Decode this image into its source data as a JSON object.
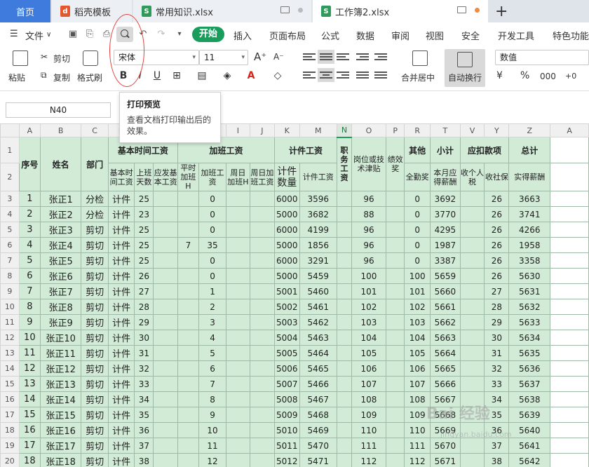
{
  "tabs": {
    "home": "首页",
    "template": "稻壳模板",
    "file1": "常用知识.xlsx",
    "file2": "工作簿2.xlsx"
  },
  "menu": {
    "file": "文件",
    "start": "开始",
    "items": [
      "插入",
      "页面布局",
      "公式",
      "数据",
      "审阅",
      "视图",
      "安全",
      "开发工具",
      "特色功能"
    ]
  },
  "ribbon": {
    "paste": "粘贴",
    "cut": "剪切",
    "copy": "复制",
    "format_painter": "格式刷",
    "font_name": "宋体",
    "font_size": "11",
    "merge_center": "合并居中",
    "wrap_text": "自动换行",
    "number_format": "数值"
  },
  "name_box": "N40",
  "tooltip": {
    "title": "打印预览",
    "desc": "查看文档打印输出后的效果。"
  },
  "columns": [
    "A",
    "B",
    "C",
    "D",
    "E",
    "F",
    "G",
    "H",
    "I",
    "J",
    "K",
    "M",
    "N",
    "O",
    "P",
    "R",
    "T",
    "V",
    "Y",
    "Z",
    "A"
  ],
  "header": {
    "row1": {
      "seq": "序号",
      "name": "姓名",
      "dept": "部门",
      "basic": "基本时间工资",
      "overtime": "加班工资",
      "piece": "计件工资",
      "post_wage": "职务工资",
      "post_allow": "岗位或技术津贴",
      "bonus": "绩效奖",
      "other": "其他",
      "subtotal": "小计",
      "deduct": "应扣款项",
      "total": "总计"
    },
    "row2": {
      "basic_time": "基本时间工资",
      "work_days": "上班天数",
      "basic_pay": "应发基本工资",
      "normal_ot": "平时加班H",
      "ot_wage": "加班工资",
      "weekend_ot": "周日加班H",
      "weekend_pay": "周日加班工资",
      "piece_qty": "计件数量",
      "piece_wage": "计件工资",
      "full_attend": "全勤奖",
      "month_pay": "本月应得薪酬",
      "income_tax": "收个人税",
      "social": "收社保",
      "net": "实得薪酬"
    }
  },
  "rows": [
    {
      "r": "3",
      "no": "1",
      "name": "张正1",
      "dept": "分检",
      "basic": "计件",
      "days": "25",
      "ot_h": "",
      "ot": "0",
      "qty": "6000",
      "piece": "3596",
      "allow": "96",
      "full": "0",
      "month": "3692",
      "social": "26",
      "net": "3663"
    },
    {
      "r": "4",
      "no": "2",
      "name": "张正2",
      "dept": "分检",
      "basic": "计件",
      "days": "23",
      "ot_h": "",
      "ot": "0",
      "qty": "5000",
      "piece": "3682",
      "allow": "88",
      "full": "0",
      "month": "3770",
      "social": "26",
      "net": "3741"
    },
    {
      "r": "5",
      "no": "3",
      "name": "张正3",
      "dept": "剪切",
      "basic": "计件",
      "days": "25",
      "ot_h": "",
      "ot": "0",
      "qty": "6000",
      "piece": "4199",
      "allow": "96",
      "full": "0",
      "month": "4295",
      "social": "26",
      "net": "4266"
    },
    {
      "r": "6",
      "no": "4",
      "name": "张正4",
      "dept": "剪切",
      "basic": "计件",
      "days": "25",
      "ot_h": "7",
      "ot": "35",
      "qty": "5000",
      "piece": "1856",
      "allow": "96",
      "full": "0",
      "month": "1987",
      "social": "26",
      "net": "1958"
    },
    {
      "r": "7",
      "no": "5",
      "name": "张正5",
      "dept": "剪切",
      "basic": "计件",
      "days": "25",
      "ot_h": "",
      "ot": "0",
      "qty": "6000",
      "piece": "3291",
      "allow": "96",
      "full": "0",
      "month": "3387",
      "social": "26",
      "net": "3358"
    },
    {
      "r": "8",
      "no": "6",
      "name": "张正6",
      "dept": "剪切",
      "basic": "计件",
      "days": "26",
      "ot_h": "",
      "ot": "0",
      "qty": "5000",
      "piece": "5459",
      "allow": "100",
      "full": "100",
      "month": "5659",
      "social": "26",
      "net": "5630"
    },
    {
      "r": "9",
      "no": "7",
      "name": "张正7",
      "dept": "剪切",
      "basic": "计件",
      "days": "27",
      "ot_h": "",
      "ot": "1",
      "qty": "5001",
      "piece": "5460",
      "allow": "101",
      "full": "101",
      "month": "5660",
      "social": "27",
      "net": "5631"
    },
    {
      "r": "10",
      "no": "8",
      "name": "张正8",
      "dept": "剪切",
      "basic": "计件",
      "days": "28",
      "ot_h": "",
      "ot": "2",
      "qty": "5002",
      "piece": "5461",
      "allow": "102",
      "full": "102",
      "month": "5661",
      "social": "28",
      "net": "5632"
    },
    {
      "r": "11",
      "no": "9",
      "name": "张正9",
      "dept": "剪切",
      "basic": "计件",
      "days": "29",
      "ot_h": "",
      "ot": "3",
      "qty": "5003",
      "piece": "5462",
      "allow": "103",
      "full": "103",
      "month": "5662",
      "social": "29",
      "net": "5633"
    },
    {
      "r": "12",
      "no": "10",
      "name": "张正10",
      "dept": "剪切",
      "basic": "计件",
      "days": "30",
      "ot_h": "",
      "ot": "4",
      "qty": "5004",
      "piece": "5463",
      "allow": "104",
      "full": "104",
      "month": "5663",
      "social": "30",
      "net": "5634"
    },
    {
      "r": "13",
      "no": "11",
      "name": "张正11",
      "dept": "剪切",
      "basic": "计件",
      "days": "31",
      "ot_h": "",
      "ot": "5",
      "qty": "5005",
      "piece": "5464",
      "allow": "105",
      "full": "105",
      "month": "5664",
      "social": "31",
      "net": "5635"
    },
    {
      "r": "14",
      "no": "12",
      "name": "张正12",
      "dept": "剪切",
      "basic": "计件",
      "days": "32",
      "ot_h": "",
      "ot": "6",
      "qty": "5006",
      "piece": "5465",
      "allow": "106",
      "full": "106",
      "month": "5665",
      "social": "32",
      "net": "5636"
    },
    {
      "r": "15",
      "no": "13",
      "name": "张正13",
      "dept": "剪切",
      "basic": "计件",
      "days": "33",
      "ot_h": "",
      "ot": "7",
      "qty": "5007",
      "piece": "5466",
      "allow": "107",
      "full": "107",
      "month": "5666",
      "social": "33",
      "net": "5637"
    },
    {
      "r": "16",
      "no": "14",
      "name": "张正14",
      "dept": "剪切",
      "basic": "计件",
      "days": "34",
      "ot_h": "",
      "ot": "8",
      "qty": "5008",
      "piece": "5467",
      "allow": "108",
      "full": "108",
      "month": "5667",
      "social": "34",
      "net": "5638"
    },
    {
      "r": "17",
      "no": "15",
      "name": "张正15",
      "dept": "剪切",
      "basic": "计件",
      "days": "35",
      "ot_h": "",
      "ot": "9",
      "qty": "5009",
      "piece": "5468",
      "allow": "109",
      "full": "109",
      "month": "5668",
      "social": "35",
      "net": "5639"
    },
    {
      "r": "18",
      "no": "16",
      "name": "张正16",
      "dept": "剪切",
      "basic": "计件",
      "days": "36",
      "ot_h": "",
      "ot": "10",
      "qty": "5010",
      "piece": "5469",
      "allow": "110",
      "full": "110",
      "month": "5669",
      "social": "36",
      "net": "5640"
    },
    {
      "r": "19",
      "no": "17",
      "name": "张正17",
      "dept": "剪切",
      "basic": "计件",
      "days": "37",
      "ot_h": "",
      "ot": "11",
      "qty": "5011",
      "piece": "5470",
      "allow": "111",
      "full": "111",
      "month": "5670",
      "social": "37",
      "net": "5641"
    },
    {
      "r": "20",
      "no": "18",
      "name": "张正18",
      "dept": "剪切",
      "basic": "计件",
      "days": "38",
      "ot_h": "",
      "ot": "12",
      "qty": "5012",
      "piece": "5471",
      "allow": "112",
      "full": "112",
      "month": "5671",
      "social": "38",
      "net": "5642"
    }
  ],
  "colors": {
    "accent": "#1a9c5d",
    "home_tab": "#3f7bdc",
    "cell_fill": "#d2ebd7",
    "annotation": "#e0443e"
  }
}
